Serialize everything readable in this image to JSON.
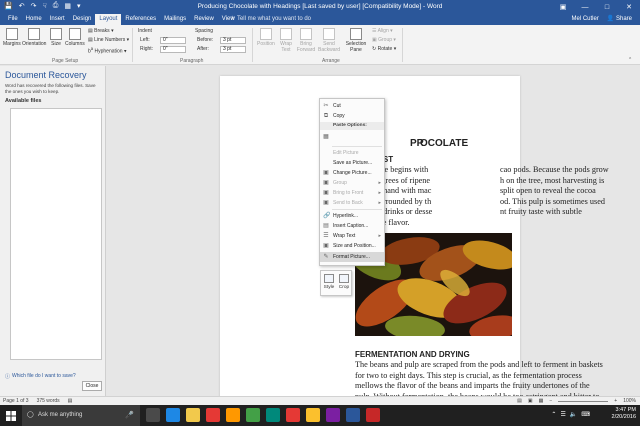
{
  "titlebar": {
    "title": "Producing Chocolate with Headings [Last saved by user] [Compatibility Mode] - Word",
    "qat": [
      "save-icon",
      "undo-icon",
      "redo-icon",
      "touch-icon",
      "print-icon",
      "touch-mode-icon",
      "customize-icon"
    ]
  },
  "tabs": [
    "File",
    "Home",
    "Insert",
    "Design",
    "Layout",
    "References",
    "Mailings",
    "Review",
    "View"
  ],
  "active_tab": "Layout",
  "tellme": "Tell me what you want to do",
  "user": {
    "name": "Mel Cutler",
    "share": "Share"
  },
  "ribbon": {
    "page_setup": {
      "label": "Page Setup",
      "margins": "Margins",
      "orientation": "Orientation",
      "size": "Size",
      "columns": "Columns",
      "breaks": "Breaks",
      "line_numbers": "Line Numbers",
      "hyphenation": "Hyphenation"
    },
    "paragraph": {
      "label": "Paragraph",
      "indent": "Indent",
      "spacing": "Spacing",
      "left_label": "Left:",
      "left_value": "0\"",
      "right_label": "Right:",
      "right_value": "0\"",
      "before_label": "Before:",
      "before_value": "3 pt",
      "after_label": "After:",
      "after_value": "3 pt"
    },
    "arrange": {
      "label": "Arrange",
      "position": "Position",
      "wrap_text": "Wrap Text",
      "bring_forward": "Bring Forward",
      "send_backward": "Send Backward",
      "selection_pane": "Selection Pane",
      "align": "Align",
      "group": "Group",
      "rotate": "Rotate"
    }
  },
  "recovery": {
    "title": "Document Recovery",
    "description": "Word has recovered the following files. Save the ones you wish to keep.",
    "available_files": "Available files",
    "which_file_link": "Which file do I want to save?",
    "close_button": "Close"
  },
  "document": {
    "title": "PRODUCING CHOCOLATE",
    "title_left": "PR",
    "title_right": "OCOLATE",
    "harvest_heading": "HARVEST",
    "harvest_lines": [
      {
        "left": "Chocolate begins with",
        "right": "cao pods. Because the pods grow"
      },
      {
        "left": "in all degrees of ripene",
        "right": "h on the tree, most harvesting is"
      },
      {
        "left": "done by hand with mac",
        "right": "split open to reveal the cocoa"
      },
      {
        "left": "beans surrounded by th",
        "right": "od. This pulp is sometimes used"
      },
      {
        "left": "to make drinks or desse",
        "right": "nt fruity taste with subtle"
      },
      {
        "left": "chocolate flavor.",
        "right": ""
      }
    ],
    "fermentation_heading": "FERMENTATION AND DRYING",
    "fermentation_lines": [
      "The beans and pulp are scraped from the pods and left to ferment in baskets",
      "for two to eight days. This step is crucial, as the fermentation process",
      "mellows the flavor of the beans and imparts the fruity undertones of the",
      "pulp. Without fermentation, the beans would be too astringent and bitter to",
      "enjoy. Many high-quality chocolates undergo a long fermentation process,"
    ]
  },
  "context_menu": {
    "cut": "Cut",
    "copy": "Copy",
    "paste_options": "Paste Options:",
    "edit_picture": "Edit Picture",
    "save_as_picture": "Save as Picture...",
    "change_picture": "Change Picture...",
    "group": "Group",
    "bring_to_front": "Bring to Front",
    "send_to_back": "Send to Back",
    "hyperlink": "Hyperlink...",
    "insert_caption": "Insert Caption...",
    "wrap_text": "Wrap Text",
    "size_and_position": "Size and Position...",
    "format_picture": "Format Picture..."
  },
  "mini_toolbar": {
    "style": "Style",
    "crop": "Crop"
  },
  "statusbar": {
    "page": "Page 1 of 3",
    "words": "375 words",
    "zoom": "100%"
  },
  "taskbar": {
    "search_placeholder": "Ask me anything",
    "time": "3:47 PM",
    "date": "2/20/2016",
    "app_colors": [
      "#4a4a4a",
      "#1e88e5",
      "#f2c94c",
      "#e53935",
      "#ff9800",
      "#43a047",
      "#00897b",
      "#e53935",
      "#fbc02d",
      "#7b1fa2",
      "#2b579a",
      "#c62828"
    ]
  },
  "colors": {
    "word_blue": "#2b579a",
    "ribbon_bg": "#f3f3f3",
    "taskbar": "#202020"
  }
}
